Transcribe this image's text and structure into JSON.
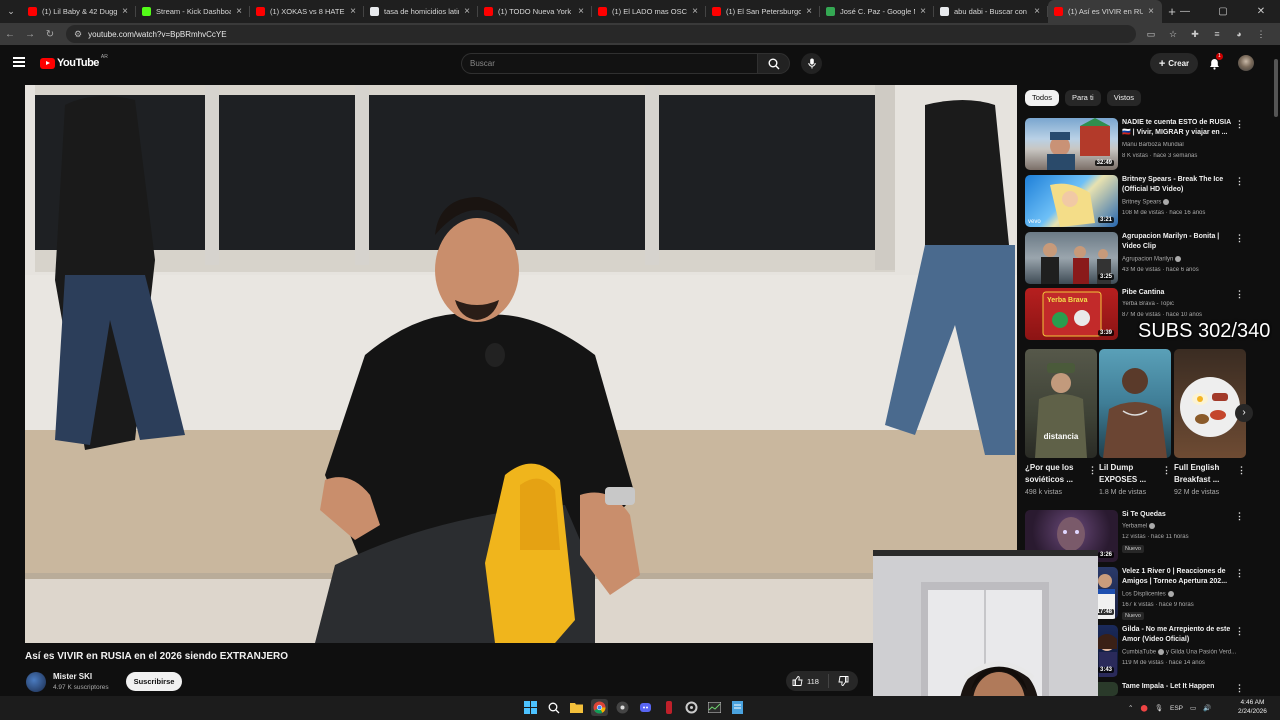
{
  "browser": {
    "tabs": [
      {
        "title": "(1) Lil Baby & 42 Dugg -",
        "favicon_color": "#ff0000"
      },
      {
        "title": "Stream - Kick Dashboard",
        "favicon_color": "#53fc18"
      },
      {
        "title": "(1) XOKAS vs 8 HATERS -",
        "favicon_color": "#ff0000"
      },
      {
        "title": "tasa de homicidios latino",
        "favicon_color": "#e8eaed"
      },
      {
        "title": "(1) TODO Nueva York en",
        "favicon_color": "#ff0000"
      },
      {
        "title": "(1) El LADO mas OSCUR",
        "favicon_color": "#ff0000"
      },
      {
        "title": "(1) El San Petersburgo q",
        "favicon_color": "#ff0000"
      },
      {
        "title": "José C. Paz - Google Ma",
        "favicon_color": "#34a853"
      },
      {
        "title": "abu dabi - Buscar con Go",
        "favicon_color": "#e8eaed"
      },
      {
        "title": "(1) Así es VIVIR en RU",
        "favicon_color": "#ff0000"
      }
    ],
    "url": "youtube.com/watch?v=BpBRmhvCcYE"
  },
  "header": {
    "logo_text": "YouTube",
    "country_code": "AR",
    "search_placeholder": "Buscar",
    "create_label": "Crear",
    "notification_count": "1"
  },
  "video": {
    "title": "Así es VIVIR en RUSIA en el 2026 siendo EXTRANJERO",
    "channel": "Mister SKI",
    "subscribers": "4.97 K suscriptores",
    "subscribe_label": "Suscribirse",
    "likes": "118"
  },
  "filters": [
    "Todos",
    "Para ti",
    "Vistos"
  ],
  "recommendations": [
    {
      "title": "NADIE te cuenta ESTO de RUSIA 🇷🇺 | Vivir, MIGRAR y viajar en ...",
      "channel": "Manu Barboza Mundial",
      "meta": "8 K vistas · hace 3 semanas",
      "duration": "32:49",
      "verified": false
    },
    {
      "title": "Britney Spears - Break The Ice (Official HD Video)",
      "channel": "Britney Spears",
      "meta": "108 M de vistas · hace 16 años",
      "duration": "3:21",
      "verified": true
    },
    {
      "title": "Agrupacion Marilyn - Bonita | Video Clip",
      "channel": "Agrupacion Marilyn",
      "meta": "43 M de vistas · hace 6 años",
      "duration": "3:25",
      "verified": true
    },
    {
      "title": "Pibe Cantina",
      "channel": "Yerba Brava - Topic",
      "meta": "87 M de vistas · hace 10 años",
      "duration": "3:39",
      "verified": false
    }
  ],
  "shorts": [
    {
      "title": "¿Por que los soviéticos ...",
      "views": "498 k vistas",
      "overlay": "distancia"
    },
    {
      "title": "Lil Dump EXPOSES ...",
      "views": "1.8 M de vistas",
      "overlay": ""
    },
    {
      "title": "Full English Breakfast ...",
      "views": "92 M de vistas",
      "overlay": ""
    }
  ],
  "recommendations2": [
    {
      "title": "Si Te Quedas",
      "channel": "Yerbamel",
      "meta": "12 vistas · hace 11 horas",
      "duration": "3:26",
      "badge": "Nuevo"
    },
    {
      "title": "Velez 1 River 0 | Reacciones de Amigos | Torneo Apertura 202...",
      "channel": "Los Displicentes",
      "meta": "167 k vistas · hace 9 horas",
      "duration": "17:48",
      "badge": "Nuevo"
    },
    {
      "title": "Gilda - No me Arrepiento de este Amor (Video Oficial)",
      "channel": "CumbiaTube",
      "meta": "119 M de vistas · hace 14 años",
      "duration": "3:43",
      "channel_extra": "y Gilda Una Pasión Verd..."
    },
    {
      "title": "Tame Impala - Let It Happen",
      "channel": "",
      "meta": "",
      "duration": ""
    }
  ],
  "stream_overlay": "SUBS 302/340",
  "taskbar": {
    "language": "ESP",
    "time": "4:46 AM",
    "date": "2/24/2026"
  }
}
